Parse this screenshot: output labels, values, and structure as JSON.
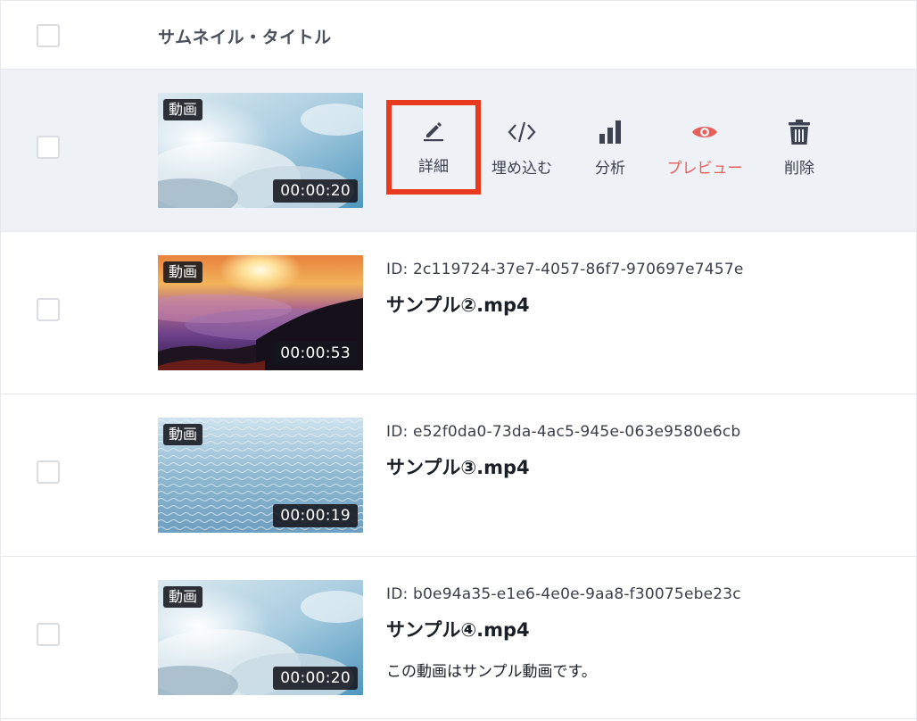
{
  "header": {
    "title": "サムネイル・タイトル"
  },
  "actions": {
    "detail": "詳細",
    "embed": "埋め込む",
    "analytics": "分析",
    "preview": "プレビュー",
    "delete": "削除"
  },
  "colors": {
    "highlight": "#e83a1e",
    "preview": "#e8605c",
    "hover_row": "#eef1f6"
  },
  "rows": [
    {
      "type": "動画",
      "duration": "00:00:20",
      "thumbnail": "sky-clouds-sun"
    },
    {
      "type": "動画",
      "duration": "00:00:53",
      "id": "ID: 2c119724-37e7-4057-86f7-970697e7457e",
      "name": "サンプル②.mp4",
      "thumbnail": "sunrise-sea-of-clouds"
    },
    {
      "type": "動画",
      "duration": "00:00:19",
      "id": "ID: e52f0da0-73da-4ac5-945e-063e9580e6cb",
      "name": "サンプル③.mp4",
      "thumbnail": "water-surface"
    },
    {
      "type": "動画",
      "duration": "00:00:20",
      "id": "ID: b0e94a35-e1e6-4e0e-9aa8-f30075ebe23c",
      "name": "サンプル④.mp4",
      "description": "この動画はサンプル動画です。",
      "thumbnail": "sky-clouds-sun"
    }
  ]
}
